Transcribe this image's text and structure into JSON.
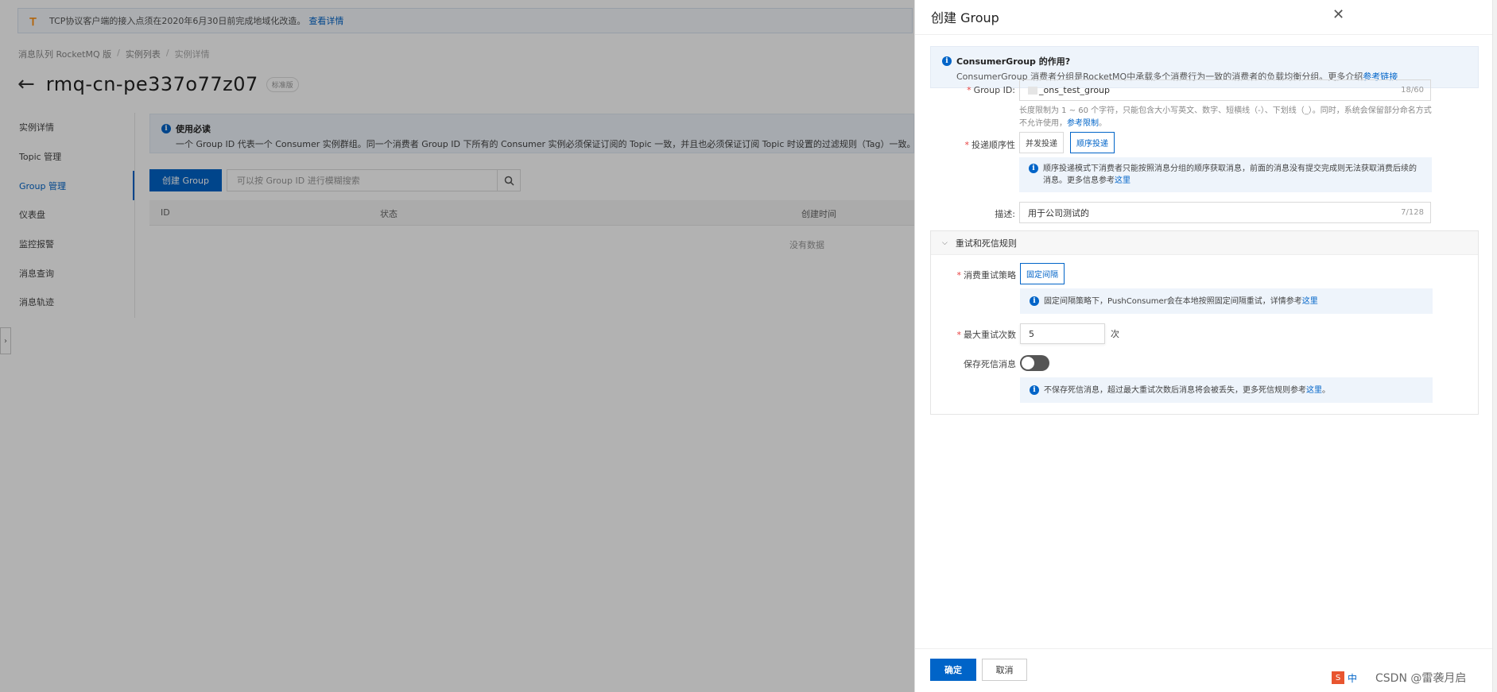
{
  "notice": {
    "text": "TCP协议客户端的接入点须在2020年6月30日前完成地域化改造。",
    "link": "查看详情"
  },
  "breadcrumb": [
    "消息队列 RocketMQ 版",
    "实例列表",
    "实例详情"
  ],
  "instance": {
    "title": "rmq-cn-pe337o77z07",
    "badge": "标准版"
  },
  "side_nav": [
    {
      "label": "实例详情"
    },
    {
      "label": "Topic 管理"
    },
    {
      "label": "Group 管理",
      "active": true
    },
    {
      "label": "仪表盘"
    },
    {
      "label": "监控报警"
    },
    {
      "label": "消息查询"
    },
    {
      "label": "消息轨迹"
    }
  ],
  "usage_tip": {
    "title": "使用必读",
    "text": "一个 Group ID 代表一个 Consumer 实例群组。同一个消费者 Group ID 下所有的 Consumer 实例必须保证订阅的 Topic 一致，并且也必须保证订阅 Topic 时设置的过滤规则（Tag）一致。否则消"
  },
  "toolbar": {
    "create_label": "创建 Group",
    "search_placeholder": "可以按 Group ID 进行模糊搜索"
  },
  "table": {
    "columns": [
      "ID",
      "状态",
      "创建时间"
    ],
    "empty": "没有数据"
  },
  "drawer": {
    "title": "创建 Group",
    "banner": {
      "title": "ConsumerGroup 的作用?",
      "text": "ConsumerGroup 消费者分组是RocketMQ中承载多个消费行为一致的消费者的负载均衡分组。更多介绍",
      "link": "参考链接"
    },
    "group_id": {
      "label": "Group ID:",
      "value": "_ons_test_group",
      "counter": "18/60",
      "hint": "长度限制为 1 ~ 60 个字符，只能包含大小写英文、数字、短横线（-）、下划线（_）。同时，系统会保留部分命名方式不允许使用，",
      "hint_link": "参考限制",
      "hint_end": "。"
    },
    "delivery": {
      "label": "投递顺序性",
      "options": [
        "并发投递",
        "顺序投递"
      ],
      "selected": "顺序投递",
      "note": "顺序投递模式下消费者只能按照消息分组的顺序获取消息，前面的消息没有提交完成则无法获取消费后续的消息。更多信息参考",
      "note_link": "这里"
    },
    "description": {
      "label": "描述:",
      "value": "用于公司测试的",
      "counter": "7/128"
    },
    "retry_section": {
      "title": "重试和死信规则",
      "strategy": {
        "label": "消费重试策略",
        "option": "固定间隔",
        "note": "固定间隔策略下，PushConsumer会在本地按照固定间隔重试，详情参考",
        "note_link": "这里"
      },
      "max_retry": {
        "label": "最大重试次数",
        "value": "5",
        "unit": "次"
      },
      "dead_letter": {
        "label": "保存死信消息",
        "enabled": false,
        "note": "不保存死信消息，超过最大重试次数后消息将会被丢失，更多死信规则参考",
        "note_link": "这里",
        "note_end": "。"
      }
    },
    "ok_label": "确定",
    "cancel_label": "取消"
  },
  "watermark": "CSDN @雷袭月启",
  "ime": {
    "s": "S",
    "zh": "中"
  },
  "colors": {
    "primary": "#0064c8",
    "required": "#e84040",
    "info_bg": "#eef4fb",
    "warn": "#ff8a00"
  }
}
